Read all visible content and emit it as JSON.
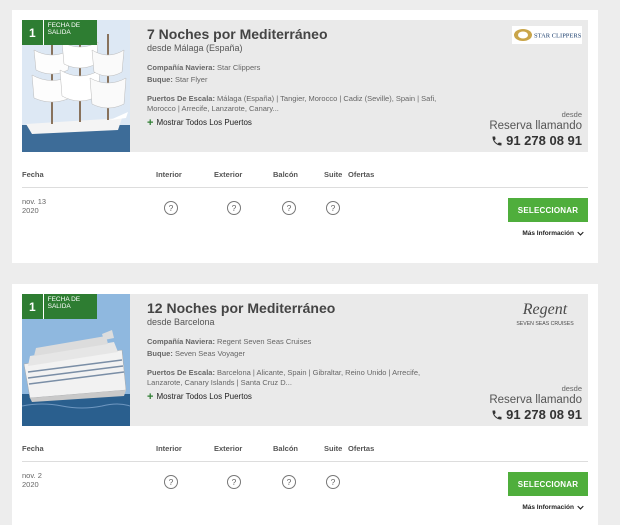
{
  "table_headers": {
    "fecha": "Fecha",
    "interior": "Interior",
    "exterior": "Exterior",
    "balcon": "Balcón",
    "suite": "Suite",
    "ofertas": "Ofertas"
  },
  "labels": {
    "badge_text": "FECHA DE SALIDA",
    "naviera_label": "Compañía Naviera:",
    "buque_label": "Buque:",
    "puertos_label": "Puertos De Escala:",
    "show_ports": "Mostrar Todos Los Puertos",
    "desde": "desde",
    "reserva": "Reserva llamando",
    "phone": "91 278 08 91",
    "select": "SELECCIONAR",
    "more_info": "Más Información",
    "price_unknown": "?"
  },
  "cruises": [
    {
      "badge_number": "1",
      "title": "7 Noches por Mediterráneo",
      "from": "desde Málaga (España)",
      "naviera": "Star Clippers",
      "buque": "Star Flyer",
      "puertos": "Málaga (España) | Tangier, Morocco | Cadiz (Seville), Spain | Safi, Morocco | Arrecife, Lanzarote, Canary...",
      "logo_text": "STAR CLIPPERS",
      "date_line1": "nov. 13",
      "date_line2": "2020"
    },
    {
      "badge_number": "1",
      "title": "12 Noches por Mediterráneo",
      "from": "desde Barcelona",
      "naviera": "Regent Seven Seas Cruises",
      "buque": "Seven Seas Voyager",
      "puertos": "Barcelona | Alicante, Spain | Gibraltar, Reino Unido | Arrecife, Lanzarote, Canary Islands | Santa Cruz D...",
      "logo_text": "Regent",
      "logo_sub": "SEVEN SEAS CRUISES",
      "date_line1": "nov. 2",
      "date_line2": "2020"
    }
  ],
  "colors": {
    "accent_green": "#2e7d32",
    "button_green": "#4fae3c",
    "background": "#ededed"
  }
}
